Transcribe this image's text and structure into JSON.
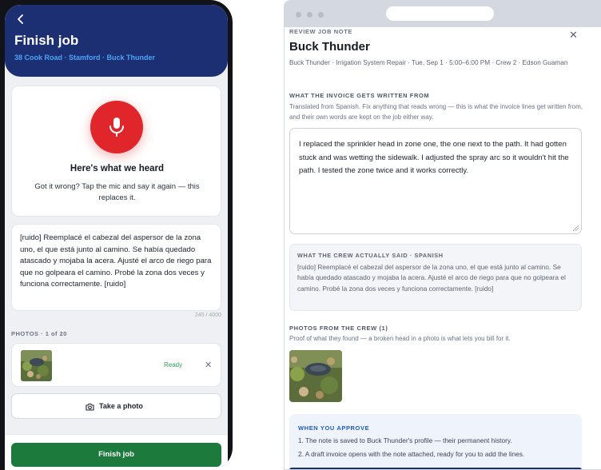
{
  "phone": {
    "title": "Finish job",
    "subtitle": "38 Cook Road · Stamford · Buck Thunder",
    "heard": {
      "title": "Here's what we heard",
      "description": "Got it wrong? Tap the mic and say it again — this replaces it."
    },
    "transcript": "[ruido] Reemplacé el cabezal del aspersor de la zona uno, el que está junto al camino. Se había quedado atascado y mojaba la acera. Ajusté el arco de riego para que no golpeara el camino. Probé la zona dos veces y funciona correctamente. [ruido]",
    "char_count": "245 / 4000",
    "photos_label": "PHOTOS · 1 of 20",
    "photo_status": "Ready",
    "take_photo_label": "Take a photo",
    "finish_label": "Finish job"
  },
  "review": {
    "kicker": "REVIEW JOB NOTE",
    "title": "Buck Thunder",
    "meta": "Buck Thunder · Irrigation System Repair · Tue, Sep 1 · 5:00–6:00 PM · Crew 2 · Edson Guaman",
    "invoice_label": "WHAT THE INVOICE GETS WRITTEN FROM",
    "invoice_help": "Translated from Spanish. Fix anything that reads wrong — this is what the invoice lines get written from, and their own words are kept on the job either way.",
    "invoice_text": "I replaced the sprinkler head in zone one, the one next to the path. It had gotten stuck and was wetting the sidewalk. I adjusted the spray arc so it wouldn't hit the path. I tested the zone twice and it works correctly.",
    "crew_label": "WHAT THE CREW ACTUALLY SAID · SPANISH",
    "crew_text": "[ruido] Reemplacé el cabezal del aspersor de la zona uno, el que está junto al camino. Se había quedado atascado y mojaba la acera. Ajusté el arco de riego para que no golpeara el camino. Probé la zona dos veces y funciona correctamente. [ruido]",
    "photos_label": "PHOTOS FROM THE CREW (1)",
    "photos_help": "Proof of what they found — a broken head in a photo is what lets you bill for it.",
    "approve_label": "WHEN YOU APPROVE",
    "approve_items": [
      "1. The note is saved to Buck Thunder's profile — their permanent history.",
      "2. A draft invoice opens with the note attached, ready for you to add the lines."
    ]
  },
  "colors": {
    "header_navy": "#1c2f72",
    "accent_blue": "#4da3f7",
    "mic_red": "#e0262b",
    "finish_green": "#1b7a3c",
    "ready_green": "#2f9b57"
  },
  "icons": [
    "back-arrow-icon",
    "microphone-icon",
    "camera-icon",
    "close-icon",
    "remove-icon"
  ]
}
